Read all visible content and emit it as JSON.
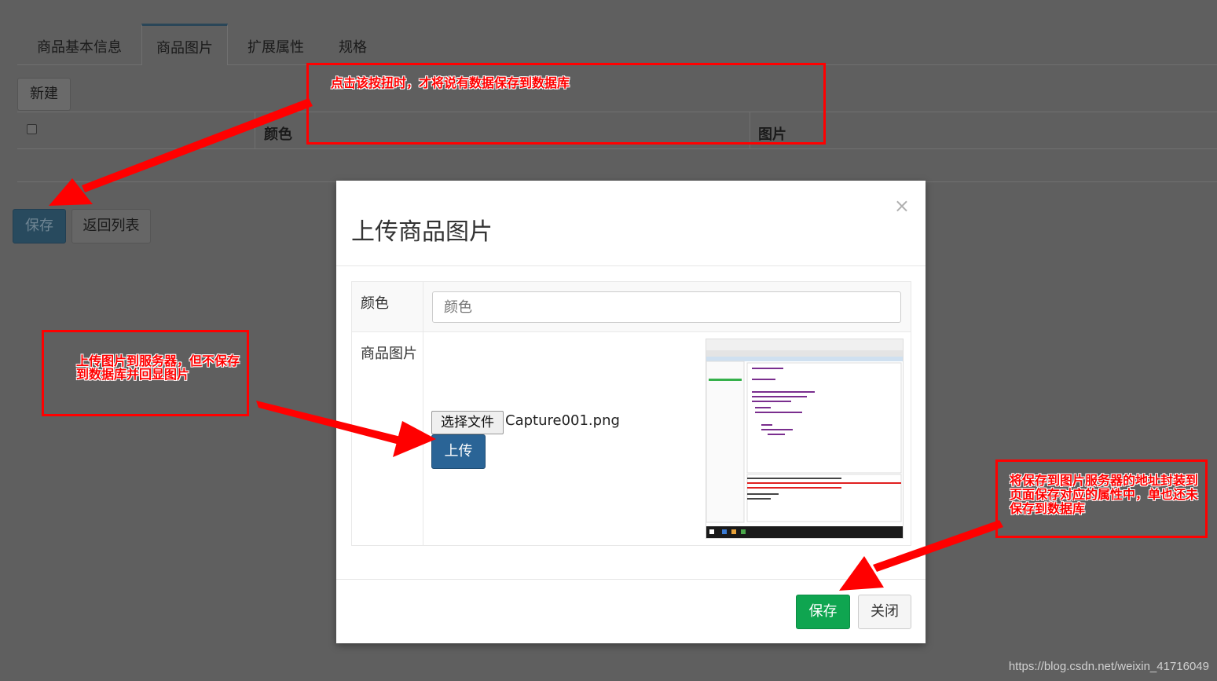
{
  "tabs": [
    "商品基本信息",
    "商品图片",
    "扩展属性",
    "规格"
  ],
  "toolbar": {
    "new_label": "新建"
  },
  "table": {
    "col_color": "颜色",
    "col_image": "图片"
  },
  "actions": {
    "save_label": "保存",
    "back_label": "返回列表"
  },
  "modal": {
    "title": "上传商品图片",
    "close_symbol": "×",
    "color_label": "颜色",
    "color_placeholder": "颜色",
    "image_label": "商品图片",
    "choose_file_label": "选择文件",
    "file_name": "Capture001.png",
    "upload_label": "上传",
    "save_label": "保存",
    "close_label": "关闭"
  },
  "annotations": {
    "top": "点击该按扭时，才将说有数据保存到数据库",
    "left_line1": "上传图片到服务器，但不保存",
    "left_line2": "到数据库并回显图片",
    "right_line1": "将保存到图片服务器的地址封装到",
    "right_line2": "页面保存对应的属性中，单也还未",
    "right_line3": "保存到数据库"
  },
  "colors": {
    "annotation": "#ff0000",
    "primary": "#2a6496",
    "success": "#0fa550"
  },
  "watermark": "https://blog.csdn.net/weixin_41716049"
}
